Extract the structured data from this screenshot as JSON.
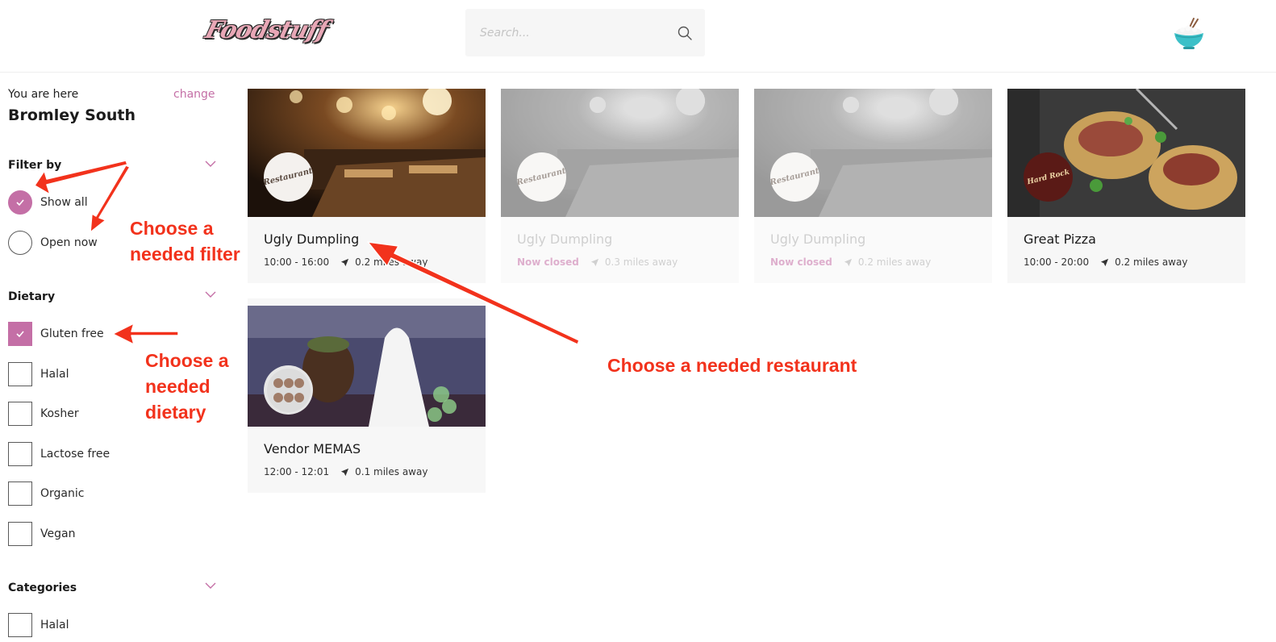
{
  "header": {
    "logo_text": "Foodstuff",
    "search_placeholder": "Search...",
    "search_icon": "search-icon",
    "avatar_icon": "rice-bowl-icon"
  },
  "sidebar": {
    "here_label": "You are here",
    "change_label": "change",
    "location": "Bromley South",
    "filter": {
      "title": "Filter by",
      "options": [
        {
          "label": "Show all",
          "checked": true
        },
        {
          "label": "Open now",
          "checked": false
        }
      ]
    },
    "dietary": {
      "title": "Dietary",
      "options": [
        {
          "label": "Gluten free",
          "checked": true
        },
        {
          "label": "Halal",
          "checked": false
        },
        {
          "label": "Kosher",
          "checked": false
        },
        {
          "label": "Lactose free",
          "checked": false
        },
        {
          "label": "Organic",
          "checked": false
        },
        {
          "label": "Vegan",
          "checked": false
        }
      ]
    },
    "categories": {
      "title": "Categories",
      "options": [
        {
          "label": "Halal",
          "checked": false
        }
      ]
    }
  },
  "restaurants": [
    {
      "name": "Ugly Dumpling",
      "hours": "10:00 - 16:00",
      "status": "",
      "distance": "0.2 miles away",
      "badge": "Restaurant",
      "open": true
    },
    {
      "name": "Ugly Dumpling",
      "hours": "",
      "status": "Now closed",
      "distance": "0.3 miles away",
      "badge": "Restaurant",
      "open": false
    },
    {
      "name": "Ugly Dumpling",
      "hours": "",
      "status": "Now closed",
      "distance": "0.2 miles away",
      "badge": "Restaurant",
      "open": false
    },
    {
      "name": "Great Pizza",
      "hours": "10:00 - 20:00",
      "status": "",
      "distance": "0.2 miles away",
      "badge": "Hard Rock",
      "open": true
    },
    {
      "name": "Vendor MEMAS",
      "hours": "12:00 - 12:01",
      "status": "",
      "distance": "0.1 miles away",
      "badge": "",
      "open": true
    }
  ],
  "annotations": {
    "filter_note": "Choose a needed filter",
    "dietary_note": "Choose a needed dietary",
    "restaurant_note": "Choose a needed restaurant"
  },
  "colors": {
    "accent": "#c46fa6",
    "annotation": "#f2321c"
  }
}
